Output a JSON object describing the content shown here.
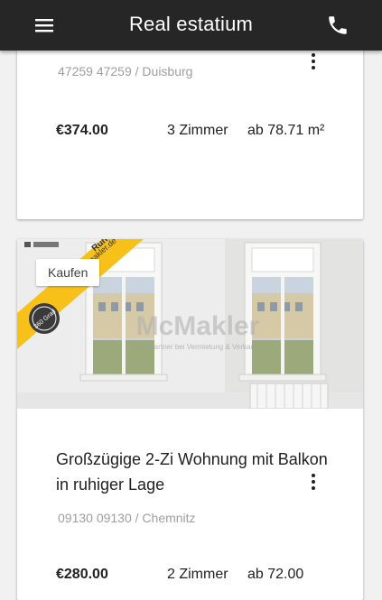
{
  "app": {
    "title": "Real estatium",
    "icons": {
      "menu": "menu-icon",
      "phone": "phone-icon",
      "more": "more-vert-icon"
    },
    "colors": {
      "appbar": "#262626",
      "banner": "#f7c11a"
    }
  },
  "listings": [
    {
      "location": "47259 47259 / Duisburg",
      "price": "€374.00",
      "rooms": "3 Zimmer",
      "area": "ab 78.71 m²"
    },
    {
      "badge": "Kaufen",
      "title": "Großzügige 2-Zi Wohnung mit Balkon in ruhiger Lage",
      "location": "09130 09130 / Chemnitz",
      "price": "€280.00",
      "rooms": "2 Zimmer",
      "area": "ab 72.00",
      "photo": {
        "watermark": "McMakler",
        "watermark_sub": "Ihr Partner bei Vermietung & Verkauf",
        "banner_text": "Rundgang",
        "banner_url": "mcmakler.de",
        "seal": "360 Grad"
      }
    }
  ]
}
